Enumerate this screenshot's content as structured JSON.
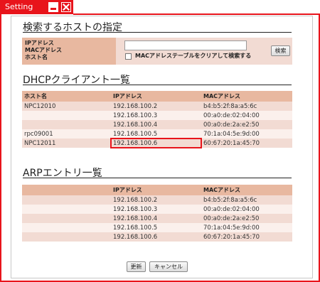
{
  "window": {
    "title": "Setting"
  },
  "search": {
    "heading": "検索するホストの指定",
    "label_ip": "IPアドレス",
    "label_mac": "MACアドレス",
    "label_host": "ホスト名",
    "input_value": "",
    "checkbox_label": "MACアドレステーブルをクリアして検索する",
    "search_button": "検索"
  },
  "dhcp": {
    "heading": "DHCPクライアント一覧",
    "columns": [
      "ホスト名",
      "IPアドレス",
      "MACアドレス"
    ],
    "rows": [
      {
        "host": "NPC12010",
        "ip": "192.168.100.2",
        "mac": "b4:b5:2f:8a:a5:6c"
      },
      {
        "host": "",
        "ip": "192.168.100.3",
        "mac": "00:a0:de:02:04:00"
      },
      {
        "host": "",
        "ip": "192.168.100.4",
        "mac": "00:a0:de:2a:e2:50"
      },
      {
        "host": "rpc09001",
        "ip": "192.168.100.5",
        "mac": "70:1a:04:5e:9d:00"
      },
      {
        "host": "NPC12011",
        "ip": "192.168.100.6",
        "mac": "60:67:20:1a:45:70"
      }
    ]
  },
  "arp": {
    "heading": "ARPエントリ一覧",
    "columns": [
      "",
      "IPアドレス",
      "MACアドレス"
    ],
    "rows": [
      {
        "ip": "192.168.100.2",
        "mac": "b4:b5:2f:8a:a5:6c"
      },
      {
        "ip": "192.168.100.3",
        "mac": "00:a0:de:02:04:00"
      },
      {
        "ip": "192.168.100.4",
        "mac": "00:a0:de:2a:e2:50"
      },
      {
        "ip": "192.168.100.5",
        "mac": "70:1a:04:5e:9d:00"
      },
      {
        "ip": "192.168.100.6",
        "mac": "60:67:20:1a:45:70"
      }
    ]
  },
  "footer": {
    "refresh_button": "更新",
    "cancel_button": "キャンセル"
  },
  "colors": {
    "accent": "#e8141b",
    "header_bg": "#e8b8a0",
    "row_odd": "#f2dbd3",
    "row_even": "#fbf0ec"
  }
}
